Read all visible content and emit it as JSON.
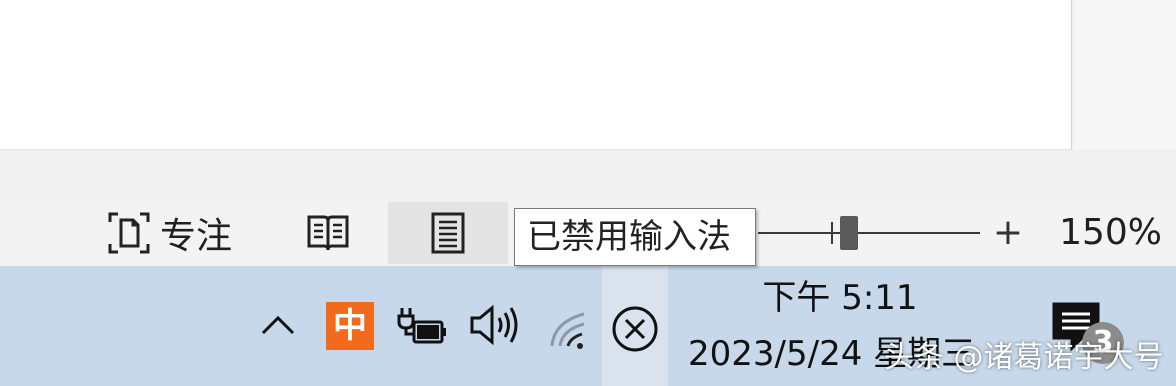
{
  "statusbar": {
    "focus_label": "专注",
    "zoom_plus": "+",
    "zoom_percent": "150%",
    "zoom_level": 150,
    "tooltip": "已禁用输入法"
  },
  "taskbar": {
    "ime_label": "中",
    "time": "下午 5:11",
    "date": "2023/5/24 星期三",
    "notification_count": "3",
    "colors": {
      "taskbar_bg": "#c7d8ea",
      "ime_accent": "#f26b1d"
    }
  },
  "icons": [
    "focus-icon",
    "read-mode-icon",
    "print-layout-icon",
    "chevron-up-icon",
    "battery-charging-icon",
    "volume-icon",
    "wifi-icon",
    "ime-disabled-icon",
    "notification-icon"
  ],
  "watermark": "头条 @诸葛诺宇大号"
}
